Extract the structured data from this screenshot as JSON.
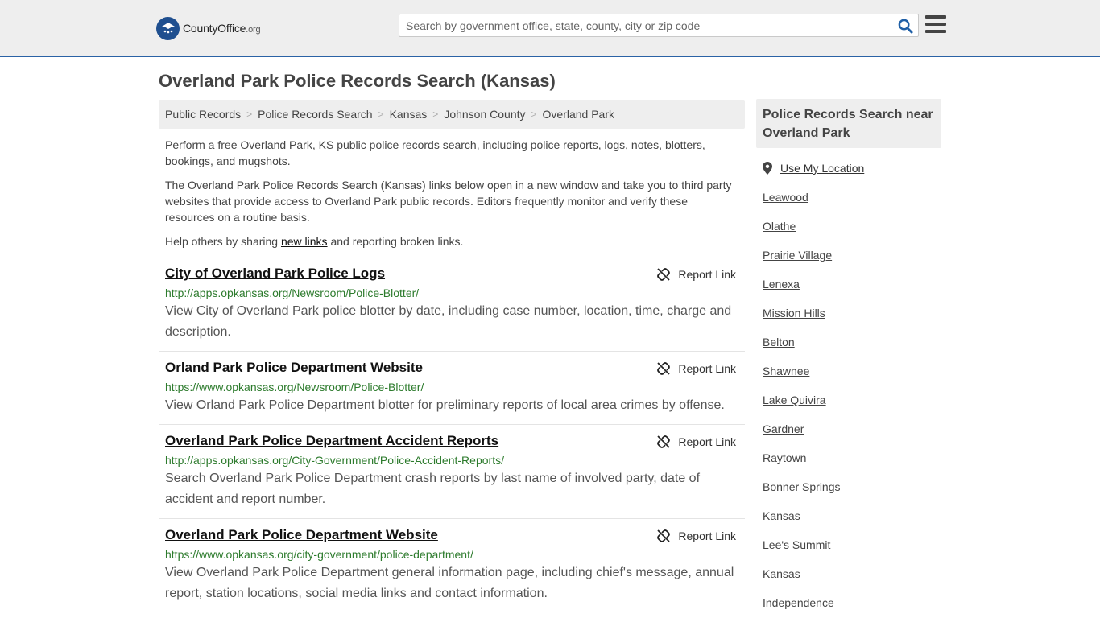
{
  "header": {
    "logo_main": "CountyOffice",
    "logo_org": ".org",
    "search_placeholder": "Search by government office, state, county, city or zip code"
  },
  "page_title": "Overland Park Police Records Search (Kansas)",
  "breadcrumb": [
    "Public Records",
    "Police Records Search",
    "Kansas",
    "Johnson County",
    "Overland Park"
  ],
  "intro": {
    "p1": "Perform a free Overland Park, KS public police records search, including police reports, logs, notes, blotters, bookings, and mugshots.",
    "p2": "The Overland Park Police Records Search (Kansas) links below open in a new window and take you to third party websites that provide access to Overland Park public records. Editors frequently monitor and verify these resources on a routine basis.",
    "p3_before": "Help others by sharing ",
    "p3_link": "new links",
    "p3_after": " and reporting broken links."
  },
  "report_label": "Report Link",
  "results": [
    {
      "title": "City of Overland Park Police Logs",
      "url": "http://apps.opkansas.org/Newsroom/Police-Blotter/",
      "desc": "View City of Overland Park police blotter by date, including case number, location, time, charge and description."
    },
    {
      "title": "Orland Park Police Department Website",
      "url": "https://www.opkansas.org/Newsroom/Police-Blotter/",
      "desc": "View Orland Park Police Department blotter for preliminary reports of local area crimes by offense."
    },
    {
      "title": "Overland Park Police Department Accident Reports",
      "url": "http://apps.opkansas.org/City-Government/Police-Accident-Reports/",
      "desc": "Search Overland Park Police Department crash reports by last name of involved party, date of accident and report number."
    },
    {
      "title": "Overland Park Police Department Website",
      "url": "https://www.opkansas.org/city-government/police-department/",
      "desc": "View Overland Park Police Department general information page, including chief's message, annual report, station locations, social media links and contact information."
    }
  ],
  "sidebar": {
    "heading": "Police Records Search near Overland Park",
    "use_location": "Use My Location",
    "nearby": [
      "Leawood",
      "Olathe",
      "Prairie Village",
      "Lenexa",
      "Mission Hills",
      "Belton",
      "Shawnee",
      "Lake Quivira",
      "Gardner",
      "Raytown",
      "Bonner Springs",
      "Kansas",
      "Lee's Summit",
      "Kansas",
      "Independence"
    ]
  }
}
